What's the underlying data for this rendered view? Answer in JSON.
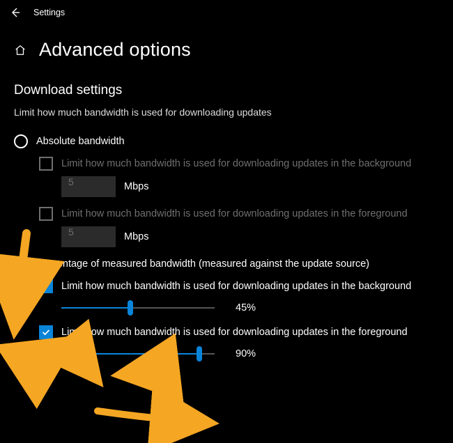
{
  "window": {
    "title": "Settings"
  },
  "page": {
    "title": "Advanced options"
  },
  "section": {
    "heading": "Download settings",
    "description": "Limit how much bandwidth is used for downloading updates"
  },
  "absolute": {
    "radio_label": "Absolute bandwidth",
    "bg_check_label": "Limit how much bandwidth is used for downloading updates in the background",
    "bg_value": "5",
    "bg_unit": "Mbps",
    "fg_check_label": "Limit how much bandwidth is used for downloading updates in the foreground",
    "fg_value": "5",
    "fg_unit": "Mbps"
  },
  "percentage": {
    "radio_label": "Percentage of measured bandwidth (measured against the update source)",
    "bg_check_label": "Limit how much bandwidth is used for downloading updates in the background",
    "bg_percent": 45,
    "bg_percent_label": "45%",
    "fg_check_label": "Limit how much bandwidth is used for downloading updates in the foreground",
    "fg_percent": 90,
    "fg_percent_label": "90%"
  },
  "colors": {
    "accent": "#0a84d8",
    "annotation": "#f5a623"
  }
}
